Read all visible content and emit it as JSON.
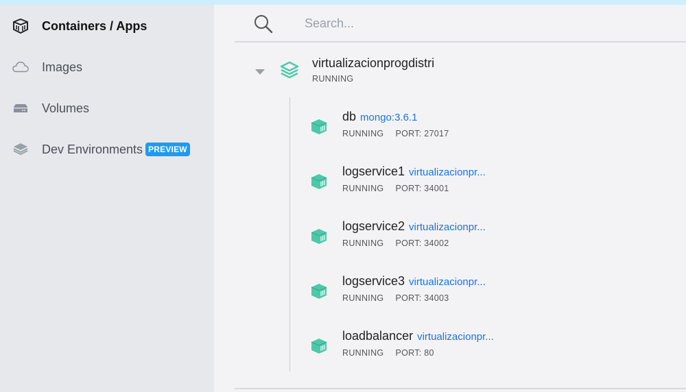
{
  "sidebar": {
    "items": [
      {
        "label": "Containers / Apps",
        "icon": "container-box-icon",
        "active": true
      },
      {
        "label": "Images",
        "icon": "cloud-icon"
      },
      {
        "label": "Volumes",
        "icon": "hard-drive-icon"
      },
      {
        "label": "Dev Environments",
        "icon": "layers-cube-icon",
        "badge": "PREVIEW"
      }
    ]
  },
  "search": {
    "placeholder": "Search..."
  },
  "app": {
    "name": "virtualizacionprogdistri",
    "status": "RUNNING",
    "containers": [
      {
        "name": "db",
        "image": "mongo:3.6.1",
        "status": "RUNNING",
        "port": "PORT: 27017"
      },
      {
        "name": "logservice1",
        "image": "virtualizacionpr...",
        "status": "RUNNING",
        "port": "PORT: 34001"
      },
      {
        "name": "logservice2",
        "image": "virtualizacionpr...",
        "status": "RUNNING",
        "port": "PORT: 34002"
      },
      {
        "name": "logservice3",
        "image": "virtualizacionpr...",
        "status": "RUNNING",
        "port": "PORT: 34003"
      },
      {
        "name": "loadbalancer",
        "image": "virtualizacionpr...",
        "status": "RUNNING",
        "port": "PORT: 80"
      }
    ]
  },
  "colors": {
    "accent_green": "#4cc9a9",
    "link_blue": "#1a73d9",
    "badge_blue": "#1d9bf0"
  }
}
